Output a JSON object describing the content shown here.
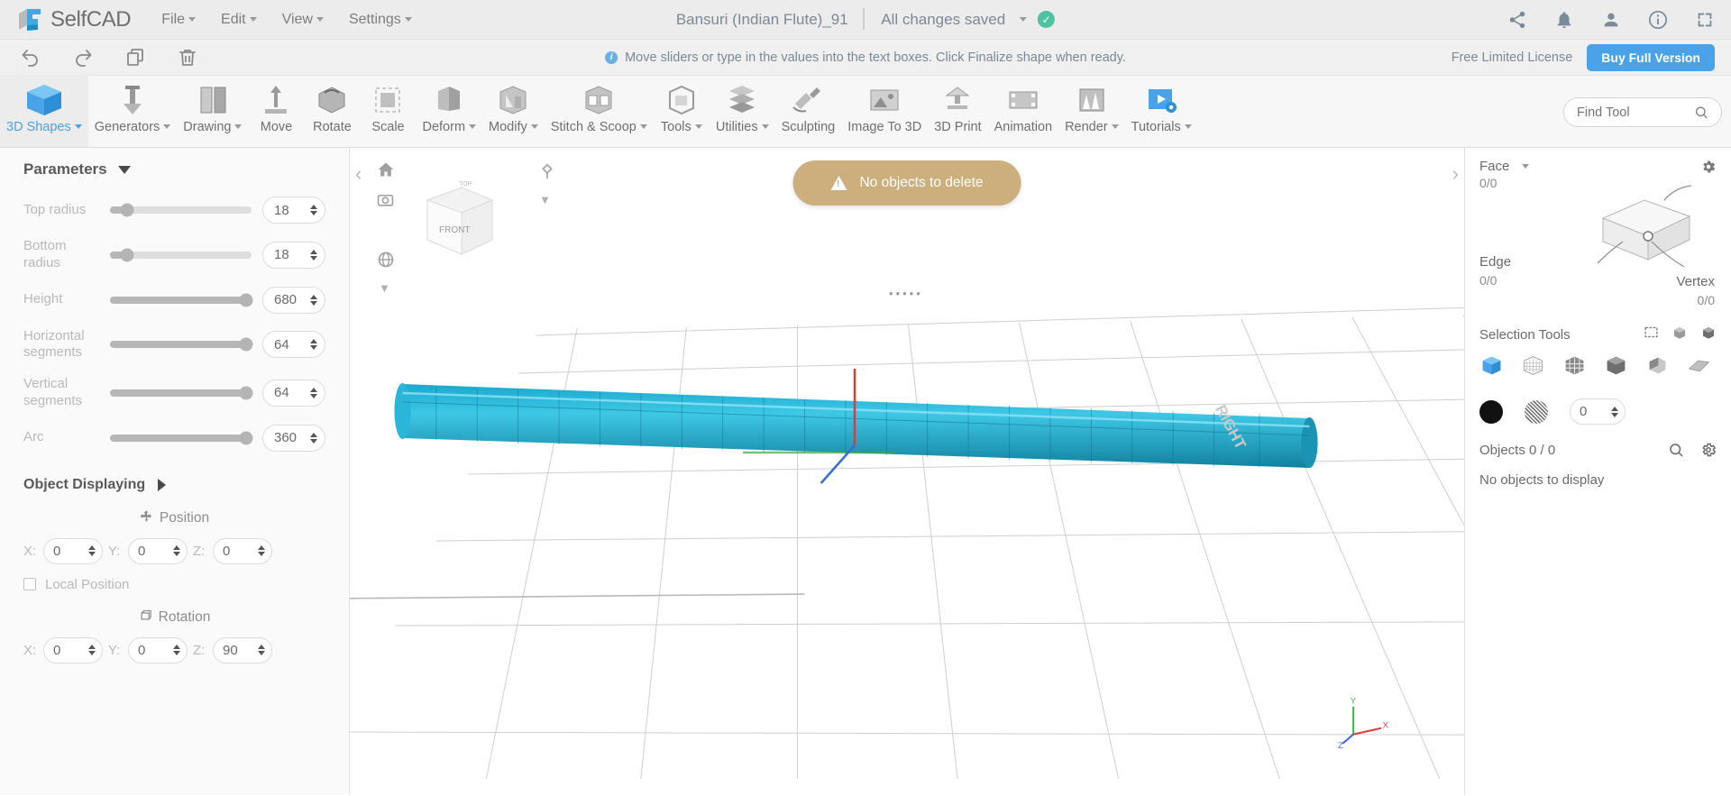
{
  "app": {
    "brand": "SelfCAD",
    "menus": [
      {
        "label": "File",
        "caret": true
      },
      {
        "label": "Edit",
        "caret": true
      },
      {
        "label": "View",
        "caret": true
      },
      {
        "label": "Settings",
        "caret": true
      }
    ],
    "document_title": "Bansuri (Indian Flute)_91",
    "save_status": "All changes saved",
    "save_icon": "check-circle-icon",
    "header_icons": [
      "share-icon",
      "bell-icon",
      "user-icon",
      "info-icon",
      "fullscreen-icon"
    ]
  },
  "notice": {
    "icon": "info-icon",
    "text": "Move sliders or type in the values into the text boxes. Click Finalize shape when ready.",
    "license_text": "Free Limited License",
    "buy_label": "Buy Full Version"
  },
  "quick_toolbar": [
    {
      "name": "undo-icon"
    },
    {
      "name": "redo-icon"
    },
    {
      "name": "copy-icon"
    },
    {
      "name": "delete-icon"
    }
  ],
  "ribbon": {
    "items": [
      {
        "label": "3D Shapes",
        "caret": true,
        "active": true,
        "icon": "cube-icon"
      },
      {
        "label": "Generators",
        "caret": true,
        "active": false,
        "icon": "generators-icon"
      },
      {
        "label": "Drawing",
        "caret": true,
        "active": false,
        "icon": "drawing-icon"
      },
      {
        "label": "Move",
        "caret": false,
        "active": false,
        "icon": "move-icon"
      },
      {
        "label": "Rotate",
        "caret": false,
        "active": false,
        "icon": "rotate-icon"
      },
      {
        "label": "Scale",
        "caret": false,
        "active": false,
        "icon": "scale-icon"
      },
      {
        "label": "Deform",
        "caret": true,
        "active": false,
        "icon": "deform-icon"
      },
      {
        "label": "Modify",
        "caret": true,
        "active": false,
        "icon": "modify-icon"
      },
      {
        "label": "Stitch & Scoop",
        "caret": true,
        "active": false,
        "icon": "stitch-scoop-icon"
      },
      {
        "label": "Tools",
        "caret": true,
        "active": false,
        "icon": "tools-icon"
      },
      {
        "label": "Utilities",
        "caret": true,
        "active": false,
        "icon": "utilities-icon"
      },
      {
        "label": "Sculpting",
        "caret": false,
        "active": false,
        "icon": "sculpting-icon"
      },
      {
        "label": "Image To 3D",
        "caret": false,
        "active": false,
        "icon": "image-to-3d-icon"
      },
      {
        "label": "3D Print",
        "caret": false,
        "active": false,
        "icon": "3d-print-icon"
      },
      {
        "label": "Animation",
        "caret": false,
        "active": false,
        "icon": "animation-icon"
      },
      {
        "label": "Render",
        "caret": true,
        "active": false,
        "icon": "render-icon"
      },
      {
        "label": "Tutorials",
        "caret": true,
        "active": false,
        "icon": "tutorials-icon"
      }
    ],
    "find_tool_placeholder": "Find Tool",
    "find_tool_value": ""
  },
  "parameters_panel": {
    "title": "Parameters",
    "rows": [
      {
        "label": "Top radius",
        "value": "18",
        "pct": 12
      },
      {
        "label": "Bottom radius",
        "value": "18",
        "pct": 12
      },
      {
        "label": "Height",
        "value": "680",
        "pct": 96
      },
      {
        "label": "Horizontal segments",
        "value": "64",
        "pct": 96
      },
      {
        "label": "Vertical segments",
        "value": "64",
        "pct": 96
      },
      {
        "label": "Arc",
        "value": "360",
        "pct": 96
      }
    ],
    "object_displaying_label": "Object Displaying",
    "position_label": "Position",
    "position": {
      "x": "0",
      "y": "0",
      "z": "0"
    },
    "local_position_label": "Local Position",
    "rotation_label": "Rotation",
    "rotation": {
      "x": "0",
      "y": "0",
      "z": "90"
    },
    "axis_labels": {
      "x": "X:",
      "y": "Y:",
      "z": "Z:"
    }
  },
  "viewport": {
    "toast": {
      "icon": "warning-icon",
      "text": "No objects to delete"
    },
    "tools": [
      "home-icon",
      "camera-icon",
      "globe-icon",
      "magnet-icon"
    ],
    "view_cube_label": "FRONT",
    "side_label": "RIGHT",
    "axis": {
      "x": "X",
      "y": "Y",
      "z": "Z"
    },
    "nav_left": "‹",
    "nav_right": "›"
  },
  "right_panel": {
    "selection_mode": "Face",
    "face_count": "0/0",
    "edge_label": "Edge",
    "edge_count": "0/0",
    "vertex_label": "Vertex",
    "vertex_count": "0/0",
    "selection_tools_label": "Selection Tools",
    "selection_icons": [
      "select-cube-icon",
      "select-wireframe-icon",
      "select-grid-icon",
      "select-solid-icon",
      "select-face-icon",
      "select-plane-icon"
    ],
    "mini_icons": [
      "rect-select-icon",
      "box-select-icon",
      "volume-select-icon"
    ],
    "material_value": "0",
    "objects_label": "Objects 0 / 0",
    "no_objects_text": "No objects to display",
    "object_actions": [
      "search-icon",
      "gear-icon"
    ],
    "settings_icon": "gear-icon"
  },
  "colors": {
    "accent": "#4aa3e8",
    "toast_bg": "#cdaf7d",
    "saved_green": "#4fc3a1",
    "model_cyan": "#29b6d8"
  }
}
